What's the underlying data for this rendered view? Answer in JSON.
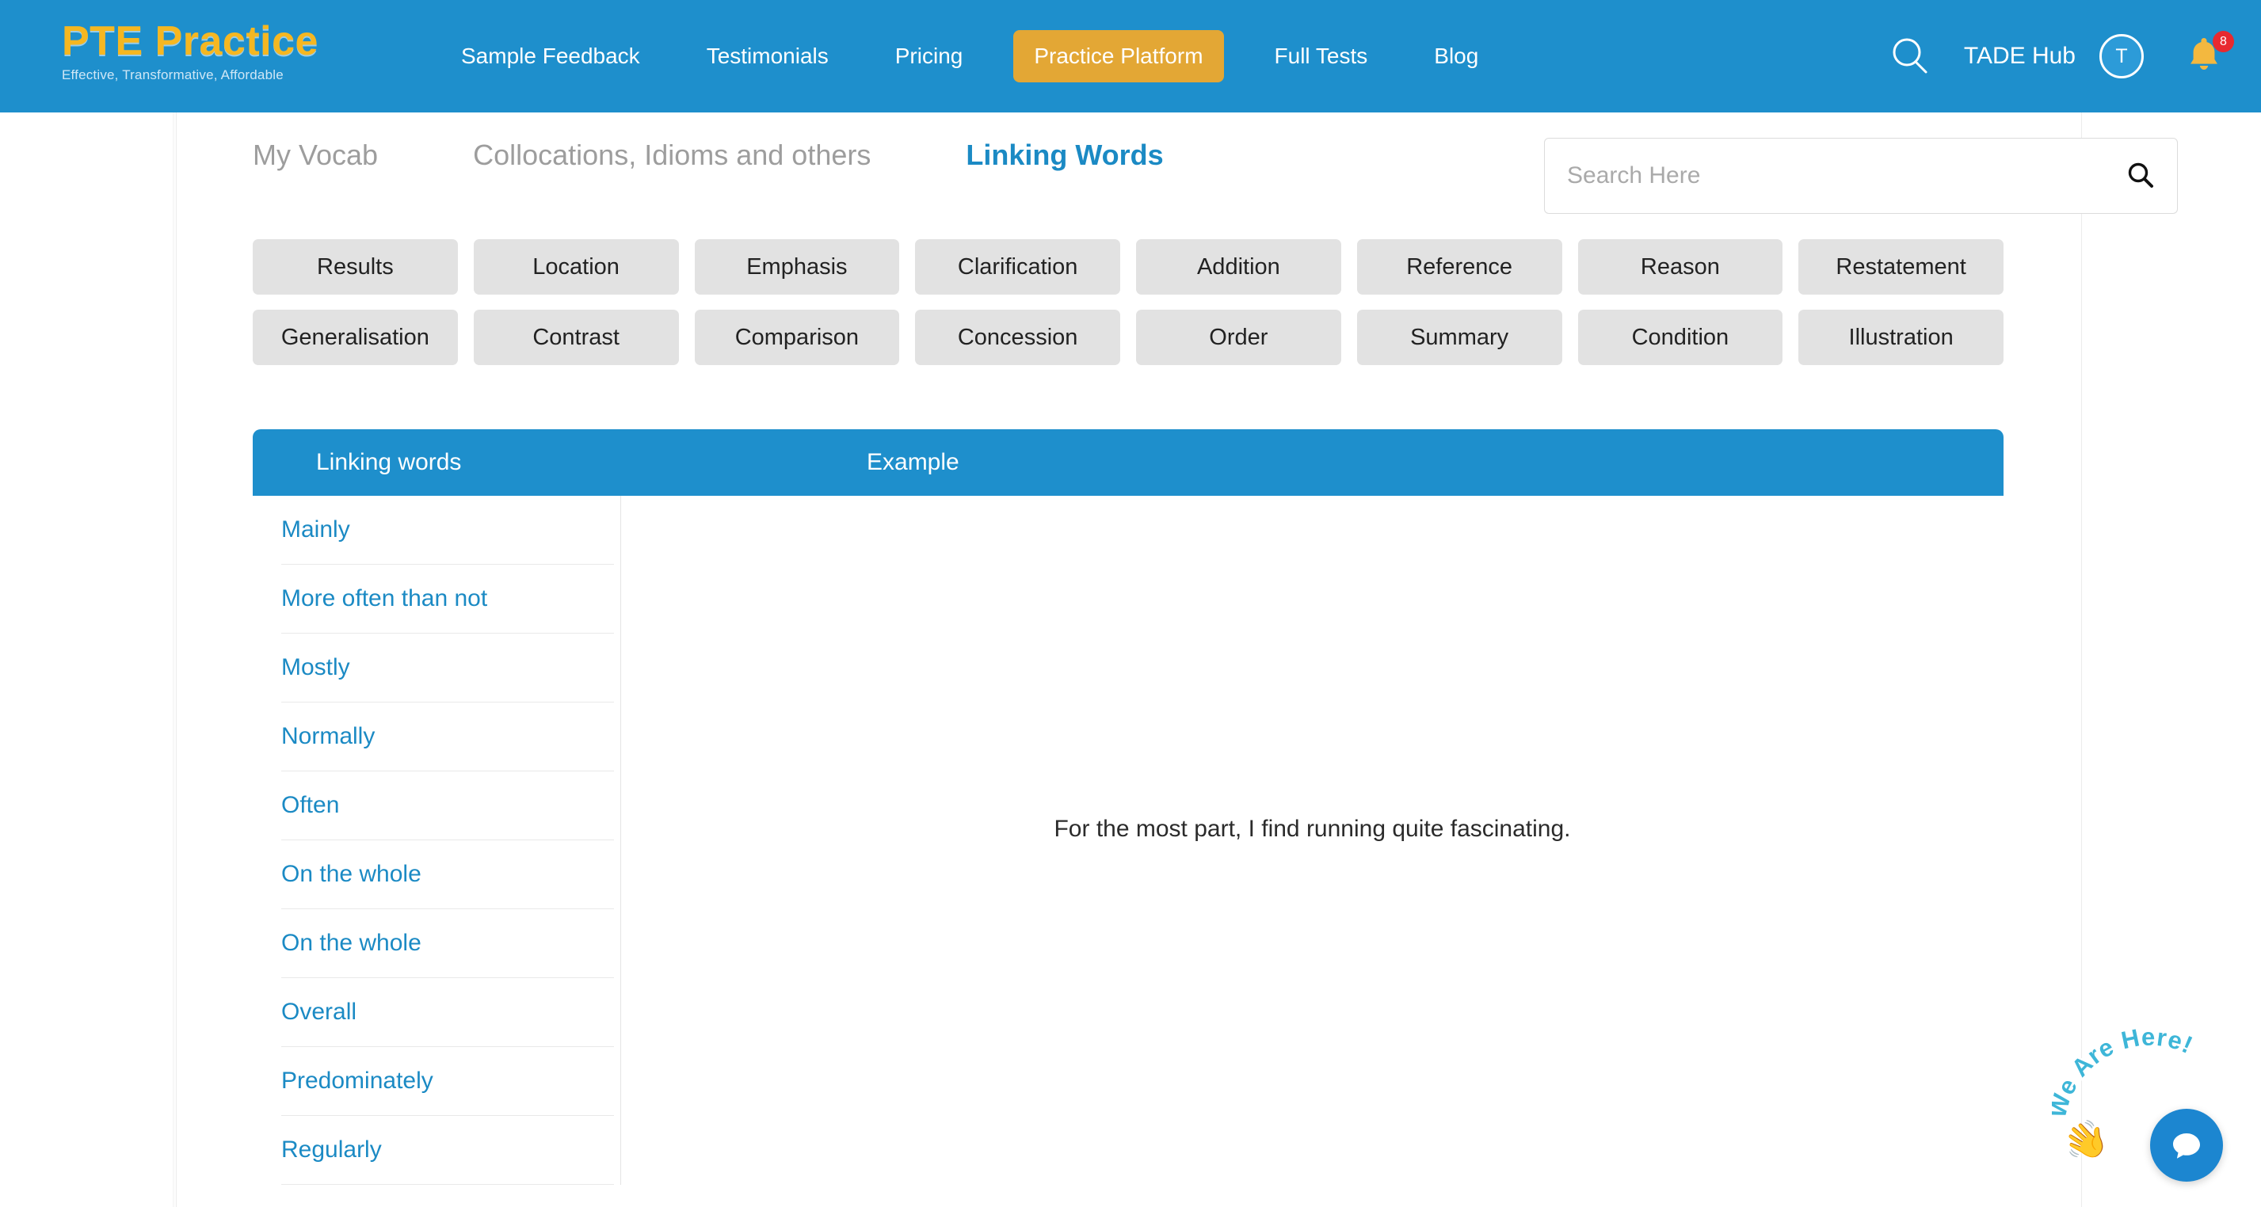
{
  "navbar": {
    "logo_title": "PTE Practice",
    "logo_tagline": "Effective, Transformative, Affordable",
    "links": [
      {
        "label": "Sample Feedback",
        "active": false
      },
      {
        "label": "Testimonials",
        "active": false
      },
      {
        "label": "Pricing",
        "active": false
      },
      {
        "label": "Practice Platform",
        "active": true
      },
      {
        "label": "Full Tests",
        "active": false
      },
      {
        "label": "Blog",
        "active": false
      }
    ],
    "search_icon": "search-icon",
    "account_label": "TADE Hub",
    "avatar_initial": "T",
    "bell_icon": "bell-icon",
    "notification_count": "8",
    "colors": {
      "navbar_bg": "#1E8FCC",
      "accent_pill": "#E3A735",
      "logo_yellow": "#F5B721",
      "badge_red": "#E8292F"
    }
  },
  "subtabs": [
    {
      "label": "My Vocab",
      "active": false
    },
    {
      "label": "Collocations, Idioms and others",
      "active": false
    },
    {
      "label": "Linking Words",
      "active": true
    }
  ],
  "search": {
    "placeholder": "Search Here",
    "value": "",
    "icon": "search-icon"
  },
  "categories": {
    "row1": [
      "Results",
      "Location",
      "Emphasis",
      "Clarification",
      "Addition",
      "Reference",
      "Reason",
      "Restatement"
    ],
    "row2": [
      "Generalisation",
      "Contrast",
      "Comparison",
      "Concession",
      "Order",
      "Summary",
      "Condition",
      "Illustration"
    ]
  },
  "table": {
    "headers": {
      "words": "Linking words",
      "example": "Example"
    },
    "words": [
      "Mainly",
      "More often than not",
      "Mostly",
      "Normally",
      "Often",
      "On the whole",
      "On the whole",
      "Overall",
      "Predominately",
      "Regularly"
    ],
    "example_text": "For the most part, I find running quite fascinating.",
    "header_bg": "#1E8FCC",
    "link_color": "#1B8AC4"
  },
  "chat_widget": {
    "label": "We Are Here!",
    "hand_icon": "waving-hand-icon",
    "button_icon": "chat-bubble-icon",
    "button_color": "#1C86D0"
  }
}
